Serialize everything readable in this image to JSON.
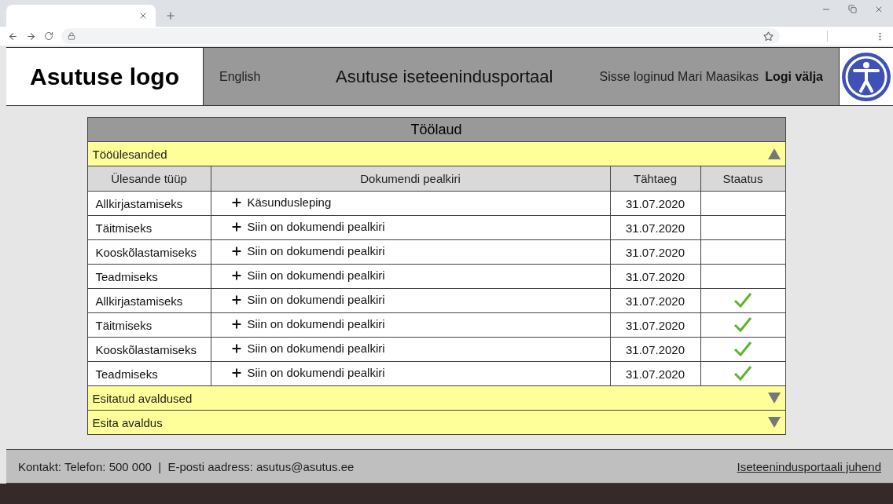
{
  "header": {
    "logo": "Asutuse logo",
    "language": "English",
    "portal_title": "Asutuse iseteenindusportaal",
    "user": "Sisse loginud Mari Maasikas",
    "logout": "Logi välja"
  },
  "dashboard": {
    "title": "Töölaud",
    "sections": [
      {
        "title": "Tööülesanded",
        "expanded": true,
        "columns": [
          "Ülesande tüüp",
          "Dokumendi pealkiri",
          "Tähtaeg",
          "Staatus"
        ],
        "rows": [
          {
            "type": "Allkirjastamiseks",
            "title": "Käsundusleping",
            "deadline": "31.07.2020",
            "done": false
          },
          {
            "type": "Täitmiseks",
            "title": "Siin on dokumendi pealkiri",
            "deadline": "31.07.2020",
            "done": false
          },
          {
            "type": "Kooskõlastamiseks",
            "title": "Siin on dokumendi pealkiri",
            "deadline": "31.07.2020",
            "done": false
          },
          {
            "type": "Teadmiseks",
            "title": "Siin on dokumendi pealkiri",
            "deadline": "31.07.2020",
            "done": false
          },
          {
            "type": "Allkirjastamiseks",
            "title": "Siin on dokumendi pealkiri",
            "deadline": "31.07.2020",
            "done": true
          },
          {
            "type": "Täitmiseks",
            "title": "Siin on dokumendi pealkiri",
            "deadline": "31.07.2020",
            "done": true
          },
          {
            "type": "Kooskõlastamiseks",
            "title": "Siin on dokumendi pealkiri",
            "deadline": "31.07.2020",
            "done": true
          },
          {
            "type": "Teadmiseks",
            "title": "Siin on dokumendi pealkiri",
            "deadline": "31.07.2020",
            "done": true
          }
        ]
      },
      {
        "title": "Esitatud avaldused",
        "expanded": false
      },
      {
        "title": "Esita avaldus",
        "expanded": false
      }
    ]
  },
  "footer": {
    "contact": "Kontakt: Telefon: 500 000  |  E-posti aadress: asutus@asutus.ee",
    "guide_link": "Iseteenindusportaali juhend"
  }
}
